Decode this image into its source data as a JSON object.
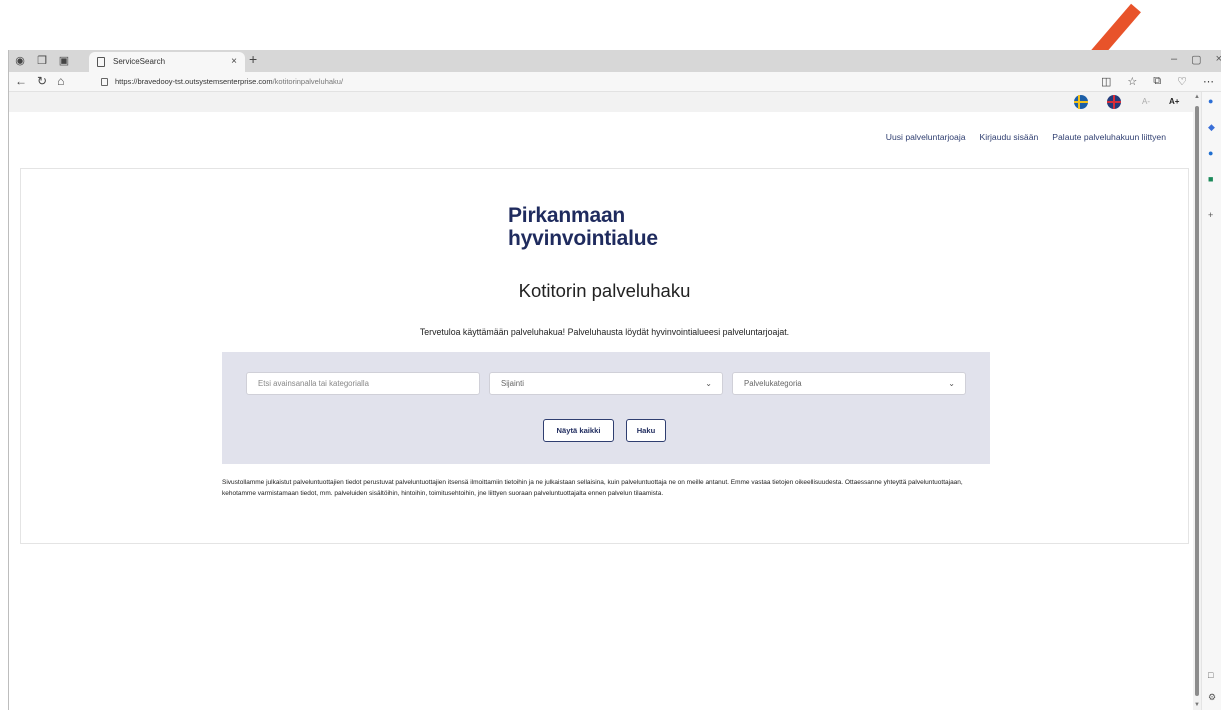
{
  "browser": {
    "tab_title": "ServiceSearch",
    "tab_close": "×",
    "new_tab": "+",
    "url_host": "https://bravedooy-tst.outsystemsenterprise.com",
    "url_path": "/kotitorinpalveluhaku/",
    "win_min": "–",
    "win_max": "▢",
    "win_close": "×"
  },
  "lang": {
    "font_decrease": "A-",
    "font_increase": "A+"
  },
  "topnav": {
    "new_provider": "Uusi palveluntarjoaja",
    "login": "Kirjaudu sisään",
    "feedback": "Palaute palveluhakuun liittyen"
  },
  "logo": {
    "line1": "Pirkanmaan",
    "line2": "hyvinvointialue"
  },
  "page": {
    "title": "Kotitorin palveluhaku",
    "welcome": "Tervetuloa käyttämään palveluhakua! Palveluhausta löydät hyvinvointialueesi palveluntarjoajat."
  },
  "search": {
    "keyword_placeholder": "Etsi avainsanalla tai kategorialla",
    "location": "Sijainti",
    "category": "Palvelukategoria",
    "show_all": "Näytä kaikki",
    "search_button": "Haku"
  },
  "disclaimer": "Sivustollamme julkaistut palveluntuottajien tiedot perustuvat palveluntuottajien itsensä ilmoittamiin tietoihin ja ne julkaistaan sellaisina, kuin palveluntuottaja ne on meille antanut. Emme vastaa tietojen oikeellisuudesta. Ottaessanne yhteyttä palveluntuottajaan, kehotamme varmistamaan tiedot, mm. palveluiden sisältöihin, hintoihin, toimitusehtoihin, jne liittyen suoraan palveluntuottajalta ennen palvelun tilaamista.",
  "colors": {
    "brand": "#1f2b5e",
    "search_bg": "#e1e2ec",
    "arrow": "#e8532a"
  }
}
